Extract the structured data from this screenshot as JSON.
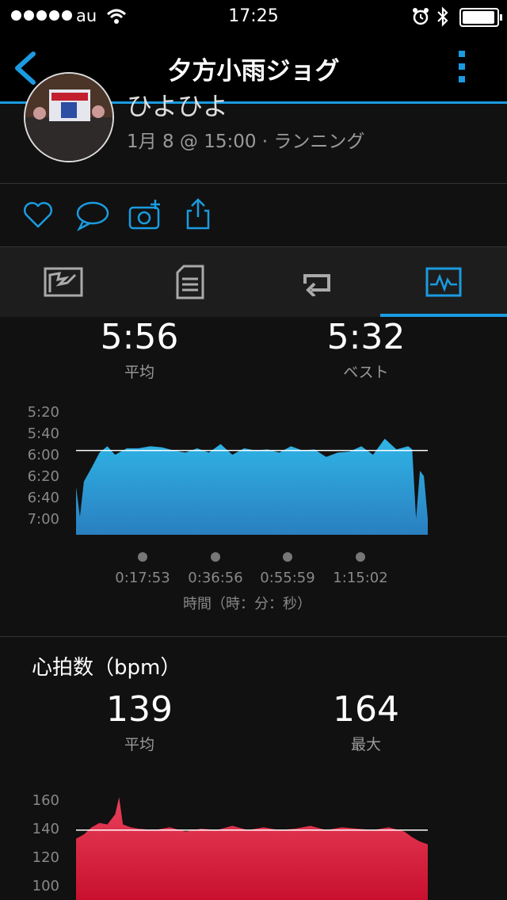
{
  "status_bar": {
    "carrier": "au",
    "time": "17:25"
  },
  "nav": {
    "title": "夕方小雨ジョグ"
  },
  "profile": {
    "name": "ひよひよ",
    "meta": "1月 8 @ 15:00 · ランニング"
  },
  "actions": [
    "heart-icon",
    "comment-icon",
    "add-photo-icon",
    "share-icon"
  ],
  "tabs": [
    "map-tab",
    "details-tab",
    "laps-tab",
    "charts-tab"
  ],
  "pace": {
    "avg_value": "5:56",
    "avg_label": "平均",
    "best_value": "5:32",
    "best_label": "ベスト",
    "xlabel": "時間（時：分：秒）"
  },
  "heart_rate": {
    "title": "心拍数（bpm）",
    "avg_value": "139",
    "avg_label": "平均",
    "max_value": "164",
    "max_label": "最大"
  },
  "colors": {
    "accent": "#1b9be0",
    "pace_fill": "#29a9e0",
    "hr_fill": "#e0364e"
  },
  "chart_data": [
    {
      "type": "area",
      "title": "",
      "ylabel": "",
      "xlabel": "時間（時：分：秒）",
      "y_ticks": [
        "5:20",
        "5:40",
        "6:00",
        "6:20",
        "6:40",
        "7:00"
      ],
      "x_ticks": [
        "0:17:53",
        "0:36:56",
        "0:55:59",
        "1:15:02"
      ],
      "reference_line": "5:56",
      "y_inverted": true,
      "x_minutes": [
        0,
        1,
        2,
        4,
        6,
        8,
        10,
        13,
        16,
        19,
        22,
        25,
        28,
        31,
        34,
        37,
        40,
        43,
        46,
        49,
        52,
        55,
        58,
        61,
        64,
        67,
        70,
        73,
        76,
        79,
        82,
        85,
        86,
        87,
        88,
        89,
        90
      ],
      "y_pace_seconds": [
        390,
        418,
        385,
        372,
        358,
        352,
        360,
        354,
        354,
        352,
        353,
        356,
        358,
        354,
        358,
        350,
        360,
        354,
        356,
        355,
        358,
        352,
        356,
        355,
        362,
        358,
        357,
        352,
        360,
        345,
        355,
        352,
        355,
        420,
        375,
        380,
        420
      ]
    },
    {
      "type": "area",
      "title": "心拍数（bpm）",
      "y_ticks": [
        "160",
        "140",
        "120",
        "100"
      ],
      "reference_line": 139,
      "x_minutes": [
        0,
        2,
        4,
        6,
        8,
        10,
        11,
        12,
        14,
        16,
        20,
        24,
        28,
        32,
        36,
        40,
        44,
        48,
        52,
        56,
        60,
        64,
        68,
        72,
        76,
        80,
        84,
        86,
        88,
        90
      ],
      "y_bpm": [
        133,
        136,
        141,
        144,
        143,
        150,
        162,
        143,
        141,
        140,
        139,
        141,
        138,
        140,
        139,
        142,
        139,
        141,
        139,
        140,
        142,
        139,
        141,
        140,
        139,
        141,
        138,
        134,
        131,
        129
      ]
    }
  ]
}
